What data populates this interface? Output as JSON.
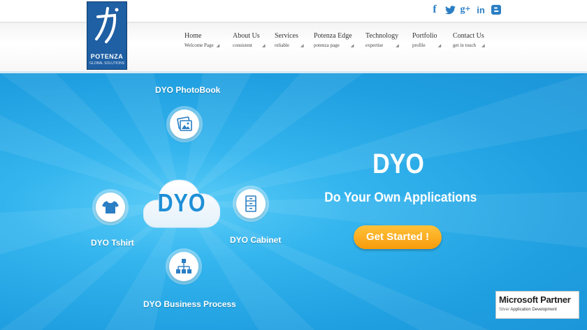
{
  "brand": {
    "name": "POTENZA",
    "tagline": "GLOBAL SOLUTIONS"
  },
  "social": [
    {
      "icon": "facebook-icon",
      "glyph": "f"
    },
    {
      "icon": "twitter-icon",
      "glyph": "🐦"
    },
    {
      "icon": "google-plus-icon",
      "glyph": "g+"
    },
    {
      "icon": "linkedin-icon",
      "glyph": "in"
    },
    {
      "icon": "blogger-icon",
      "glyph": "B"
    }
  ],
  "nav": [
    {
      "label": "Home",
      "sub": "Welcome Page"
    },
    {
      "label": "About Us",
      "sub": "consistent"
    },
    {
      "label": "Services",
      "sub": "reliable"
    },
    {
      "label": "Potenza Edge",
      "sub": "potenza page"
    },
    {
      "label": "Technology",
      "sub": "expertise"
    },
    {
      "label": "Portfolio",
      "sub": "profile"
    },
    {
      "label": "Contact Us",
      "sub": "get in touch"
    }
  ],
  "hero": {
    "cloud_text": "DYO",
    "items": {
      "photobook": "DYO PhotoBook",
      "tshirt": "DYO Tshirt",
      "cabinet": "DYO Cabinet",
      "business": "DYO Business Process"
    },
    "title": "DYO",
    "subtitle": "Do Your Own Applications",
    "cta": "Get Started !"
  },
  "partner": {
    "title": "Microsoft Partner",
    "level": "Silver",
    "competency": "Application Development"
  },
  "colors": {
    "accent": "#1f9fe0",
    "button": "#f7a51c",
    "brand": "#1f5fa3"
  }
}
